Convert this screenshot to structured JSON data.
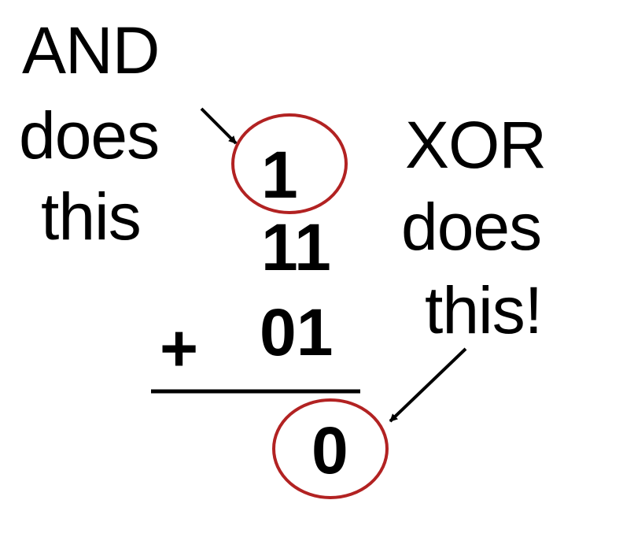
{
  "and_label": {
    "line1": "AND",
    "line2": "does",
    "line3": "this"
  },
  "xor_label": {
    "line1": "XOR",
    "line2": "does",
    "line3": "this!"
  },
  "sum": {
    "carry": "1",
    "top_operand": "11",
    "operator": "+",
    "bottom_operand": "01",
    "result": "0"
  },
  "colors": {
    "text": "#000000",
    "highlight_circle": "#b22222",
    "arrow": "#000000"
  }
}
